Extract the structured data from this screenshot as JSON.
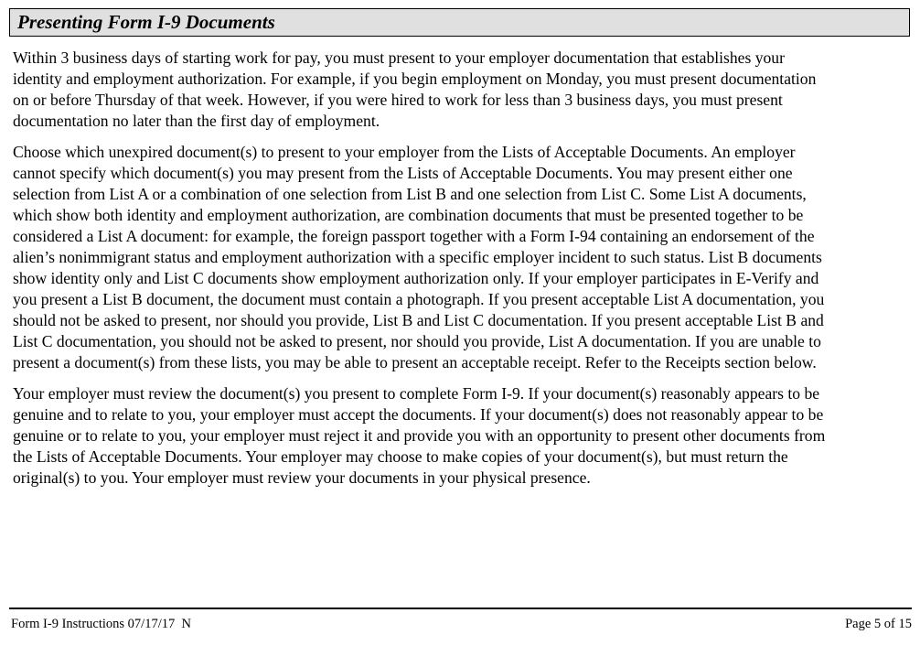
{
  "header": {
    "title": "Presenting Form I-9 Documents"
  },
  "paragraphs": [
    [
      "Within 3 business days of starting work for pay, you must present to your employer documentation that establishes your",
      "identity and employment authorization. For example, if you begin employment on Monday, you must present documentation",
      "on or before Thursday of that week. However, if you were hired to work for less than 3 business days, you must present",
      "documentation no later than the first day of employment."
    ],
    [
      "Choose which unexpired document(s) to present to your employer from the Lists of Acceptable Documents. An employer",
      "cannot specify which document(s) you may present from the Lists of Acceptable Documents. You may present either one",
      "selection from List A or a combination of one selection from List B and one selection from List C. Some List A documents,",
      "which show both identity and employment authorization, are combination documents that must be presented together to be",
      "considered a List A document: for example, the foreign passport together with a Form I-94 containing an endorsement of the",
      "alien’s nonimmigrant status and employment authorization with a specific employer incident to such status. List B documents",
      "show identity only and List C documents show employment authorization only. If your employer participates in E-Verify and",
      "you present a List B document, the document must contain a photograph. If you present acceptable List A documentation, you",
      "should not be asked to present, nor should you provide, List B and List C documentation. If you present acceptable List B and",
      "List C documentation, you should not be asked to present, nor should you provide, List A documentation. If you are unable to",
      "present a document(s) from these lists, you may be able to present an acceptable receipt. Refer to the Receipts section below."
    ],
    [
      "Your employer must review the document(s) you present to complete Form I-9. If your document(s) reasonably appears to be",
      "genuine and to relate to you, your employer must accept the documents. If your document(s) does not reasonably appear to be",
      "genuine or to relate to you, your employer must reject it and provide you with an opportunity to present other documents from",
      "the Lists of Acceptable Documents. Your employer may choose to make copies of your document(s), but must return the",
      "original(s) to you. Your employer must review your documents in your physical presence."
    ]
  ],
  "footer": {
    "left": "Form I-9 Instructions 07/17/17  N",
    "right": "Page 5 of 15"
  }
}
